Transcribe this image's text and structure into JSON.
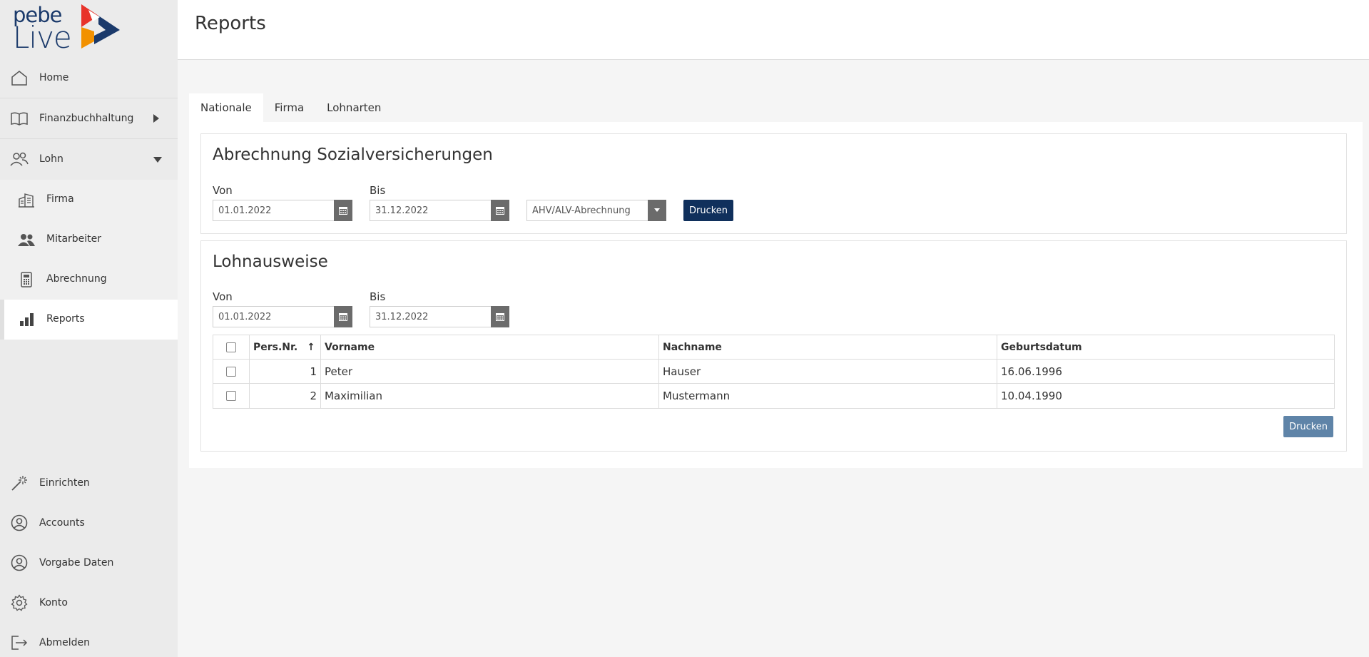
{
  "logo": {
    "line1": "pebe",
    "line2": "Live"
  },
  "sidebar": {
    "items": [
      {
        "label": "Home",
        "icon": "home-icon"
      },
      {
        "label": "Finanzbuchhaltung",
        "icon": "book-icon",
        "expand": "collapsed"
      },
      {
        "label": "Lohn",
        "icon": "users-icon",
        "expand": "expanded"
      }
    ],
    "sub_items": [
      {
        "label": "Firma",
        "icon": "building-icon"
      },
      {
        "label": "Mitarbeiter",
        "icon": "people-icon"
      },
      {
        "label": "Abrechnung",
        "icon": "calculator-icon"
      },
      {
        "label": "Reports",
        "icon": "bar-chart-icon",
        "active": true
      }
    ],
    "bottom_items": [
      {
        "label": "Einrichten",
        "icon": "magic-wand-icon"
      },
      {
        "label": "Accounts",
        "icon": "account-circle-icon"
      },
      {
        "label": "Vorgabe Daten",
        "icon": "account-circle-icon"
      },
      {
        "label": "Konto",
        "icon": "gear-icon"
      },
      {
        "label": "Abmelden",
        "icon": "logout-icon"
      }
    ]
  },
  "header": {
    "title": "Reports"
  },
  "tabs": [
    {
      "label": "Nationale",
      "active": true
    },
    {
      "label": "Firma"
    },
    {
      "label": "Lohnarten"
    }
  ],
  "sozial": {
    "title": "Abrechnung Sozialversicherungen",
    "von_label": "Von",
    "von_value": "01.01.2022",
    "bis_label": "Bis",
    "bis_value": "31.12.2022",
    "type_value": "AHV/ALV-Abrechnung",
    "print_label": "Drucken"
  },
  "lohnausweise": {
    "title": "Lohnausweise",
    "von_label": "Von",
    "von_value": "01.01.2022",
    "bis_label": "Bis",
    "bis_value": "31.12.2022",
    "columns": {
      "persnr": "Pers.Nr.",
      "vorname": "Vorname",
      "nachname": "Nachname",
      "geburtsdatum": "Geburtsdatum"
    },
    "sort_indicator": "↑",
    "rows": [
      {
        "persnr": "1",
        "vorname": "Peter",
        "nachname": "Hauser",
        "geburtsdatum": "16.06.1996"
      },
      {
        "persnr": "2",
        "vorname": "Maximilian",
        "nachname": "Mustermann",
        "geburtsdatum": "10.04.1990"
      }
    ],
    "print_label": "Drucken"
  },
  "colors": {
    "primary": "#10305c",
    "secondary": "#5f84a8",
    "sidebar": "#ebebeb",
    "logo_red": "#e8332a",
    "logo_orange": "#f29100",
    "logo_blue": "#1b3a6b"
  }
}
